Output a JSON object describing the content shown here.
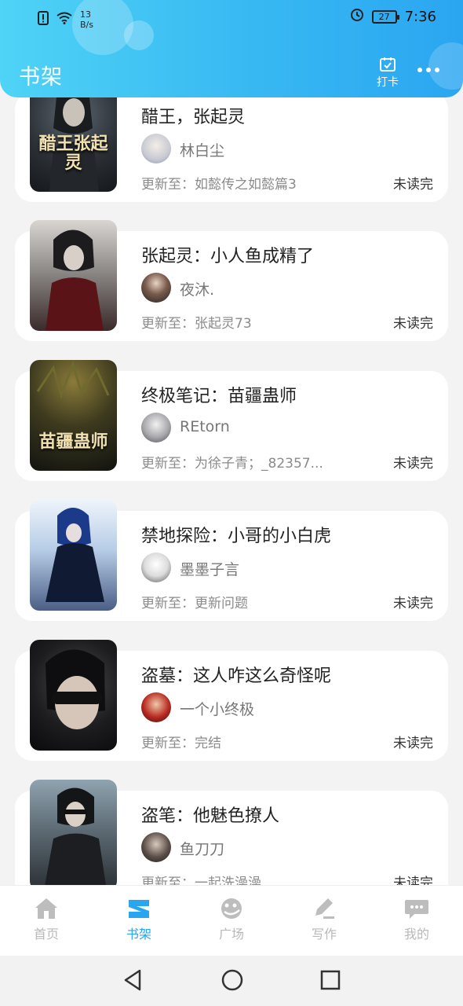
{
  "status_bar": {
    "speed_value": "13",
    "speed_unit": "B/s",
    "battery": "27",
    "time": "7:36"
  },
  "header": {
    "title": "书架",
    "checkin_label": "打卡"
  },
  "colors": {
    "accent": "#2aa6f1",
    "header_start": "#4fd3f6"
  },
  "books": [
    {
      "title": "醋王，张起灵",
      "author": "林白尘",
      "update": "更新至：如懿传之如懿篇3",
      "status": "未读完",
      "cover_text": "醋王张起灵"
    },
    {
      "title": "张起灵：小人鱼成精了",
      "author": "夜沐.",
      "update": "更新至：张起灵73",
      "status": "未读完",
      "cover_text": ""
    },
    {
      "title": "终极笔记：苗疆蛊师",
      "author": "REtorn",
      "update": "更新至：为徐子青；_82357...",
      "status": "未读完",
      "cover_text": "苗疆蛊师"
    },
    {
      "title": "禁地探险：小哥的小白虎",
      "author": "墨墨子言",
      "update": "更新至：更新问题",
      "status": "未读完",
      "cover_text": ""
    },
    {
      "title": "盗墓：这人咋这么奇怪呢",
      "author": "一个小终极",
      "update": "更新至：完结",
      "status": "未读完",
      "cover_text": ""
    },
    {
      "title": "盗笔：他魅色撩人",
      "author": "鱼刀刀",
      "update": "更新至：一起洗澡澡",
      "status": "未读完",
      "cover_text": ""
    }
  ],
  "tabs": [
    {
      "label": "首页",
      "icon": "home-icon"
    },
    {
      "label": "书架",
      "icon": "bookshelf-icon"
    },
    {
      "label": "广场",
      "icon": "plaza-icon"
    },
    {
      "label": "写作",
      "icon": "pen-icon"
    },
    {
      "label": "我的",
      "icon": "chat-bubble-icon"
    }
  ],
  "active_tab": "书架"
}
